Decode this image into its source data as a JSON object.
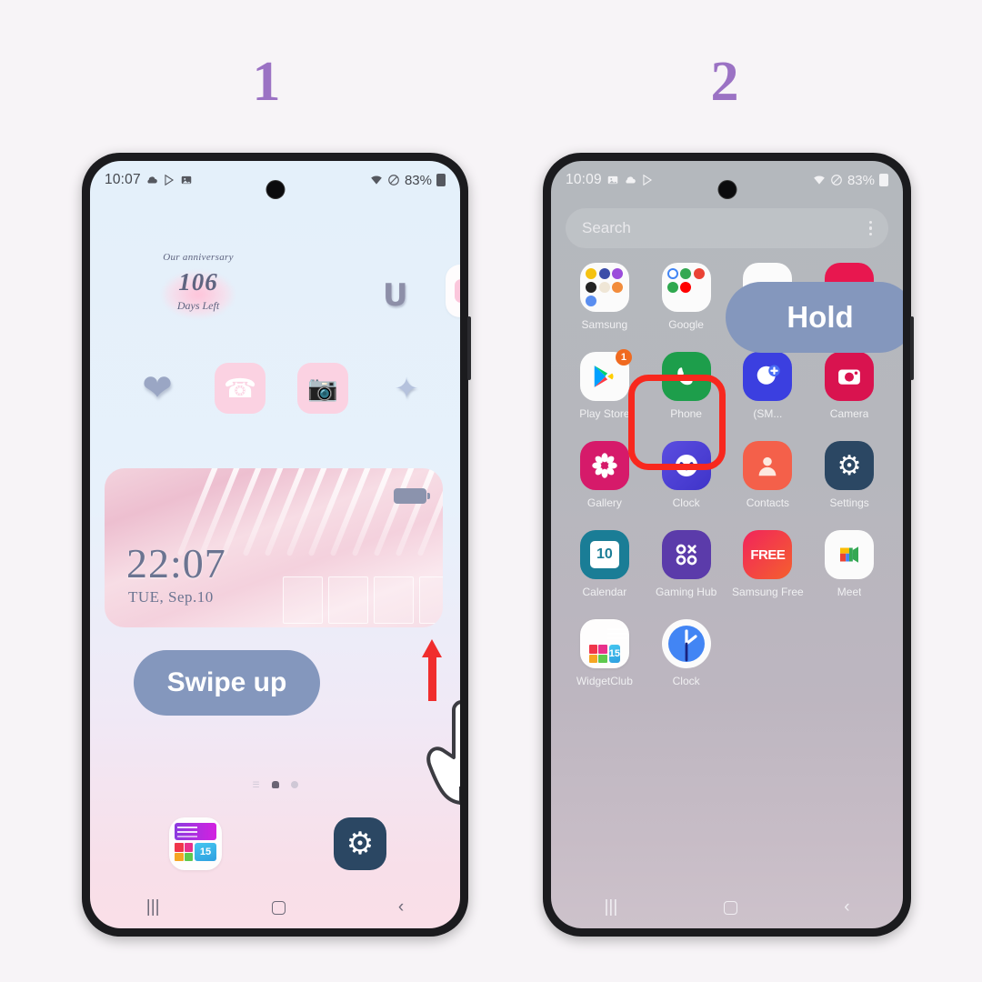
{
  "steps": {
    "one": "1",
    "two": "2"
  },
  "phone1": {
    "status": {
      "time": "10:07",
      "battery": "83%",
      "icons": [
        "cloud-icon",
        "play-store-icon",
        "gallery-icon",
        "wifi-icon",
        "dnd-icon",
        "battery-icon"
      ]
    },
    "anniversary_widget": {
      "title": "Our anniversary",
      "count": "106",
      "subtitle": "Days Left"
    },
    "clock_widget": {
      "time": "22:07",
      "date": "TUE, Sep.10"
    },
    "icons_row": [
      "heart-icon",
      "phone-icon",
      "camera-icon",
      "stars-icon"
    ],
    "u_widget": "U",
    "bubble": "Swipe up",
    "dock": [
      {
        "label": "WidgetClub",
        "num": "15"
      },
      {
        "label": "Settings"
      }
    ],
    "navbar": {
      "recents": "|||",
      "home": "home",
      "back": "‹"
    }
  },
  "phone2": {
    "status": {
      "time": "10:09",
      "battery": "83%"
    },
    "search": {
      "placeholder": "Search"
    },
    "bubble": "Hold",
    "apps": [
      {
        "label": "Samsung",
        "type": "folder"
      },
      {
        "label": "Google",
        "type": "folder"
      },
      {
        "label": "",
        "type": "hidden-white"
      },
      {
        "label": "",
        "type": "hidden-pink"
      },
      {
        "label": "Play Store",
        "type": "playstore",
        "badge": "1"
      },
      {
        "label": "Phone",
        "type": "phone",
        "highlighted": true
      },
      {
        "label": "(SM...",
        "type": "messages"
      },
      {
        "label": "Camera",
        "type": "camera"
      },
      {
        "label": "Gallery",
        "type": "gallery"
      },
      {
        "label": "Clock",
        "type": "clock-samsung"
      },
      {
        "label": "Contacts",
        "type": "contacts"
      },
      {
        "label": "Settings",
        "type": "settings"
      },
      {
        "label": "Calendar",
        "type": "calendar",
        "day": "10"
      },
      {
        "label": "Gaming Hub",
        "type": "gaminghub"
      },
      {
        "label": "Samsung Free",
        "type": "samsungfree",
        "text": "FREE"
      },
      {
        "label": "Meet",
        "type": "meet"
      },
      {
        "label": "WidgetClub",
        "type": "widgetclub",
        "num": "15"
      },
      {
        "label": "Clock",
        "type": "clock-google"
      }
    ],
    "navbar": {
      "recents": "|||",
      "home": "home",
      "back": "‹"
    }
  },
  "colors": {
    "step_number": "#9b72c4",
    "bubble": "#8497bd",
    "highlight": "#f8281e",
    "arrow": "#f02d2d",
    "page_bg": "#f7f4f7"
  }
}
